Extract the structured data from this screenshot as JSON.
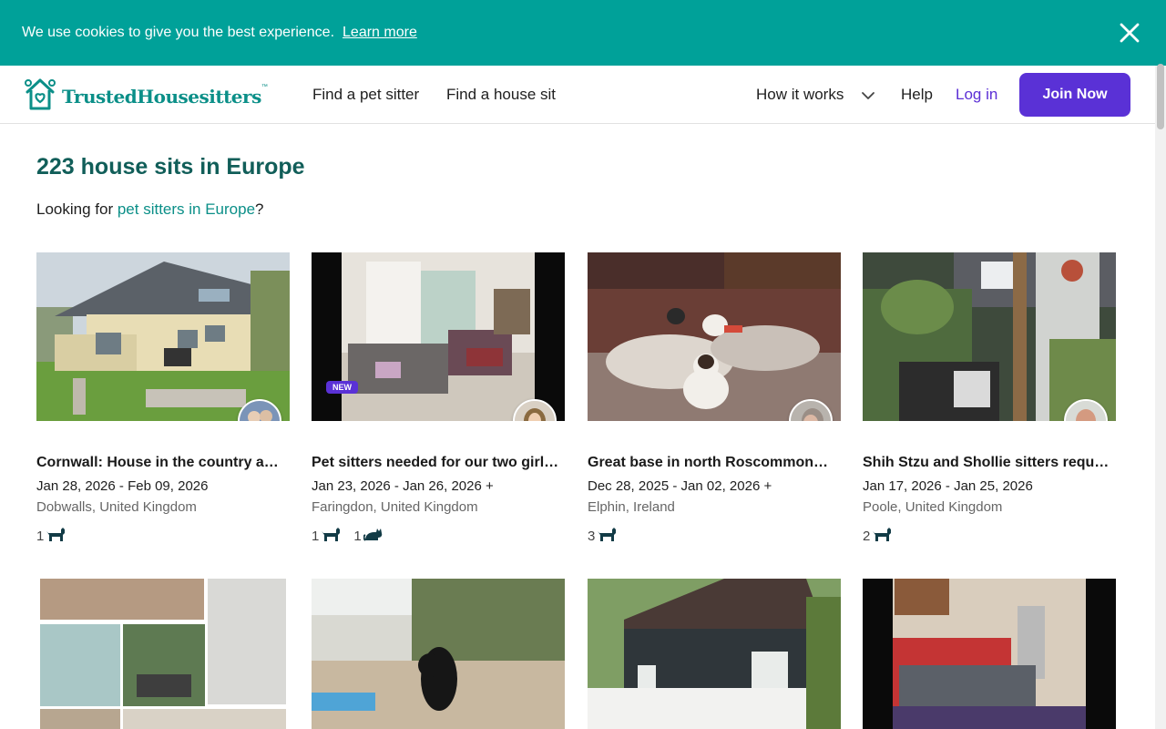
{
  "cookie": {
    "text": "We use cookies to give you the best experience.",
    "link": "Learn more"
  },
  "header": {
    "logo_text": "TrustedHousesitters",
    "logo_tm": "™",
    "nav": {
      "find_pet_sitter": "Find a pet sitter",
      "find_house_sit": "Find a house sit",
      "how_it_works": "How it works",
      "help": "Help",
      "login": "Log in",
      "join": "Join Now"
    }
  },
  "main": {
    "title": "223 house sits in Europe",
    "looking_prefix": "Looking for ",
    "looking_link": "pet sitters in Europe",
    "looking_suffix": "?"
  },
  "colors": {
    "brand_teal": "#00A199",
    "brand_dark_teal": "#115E59",
    "accent_purple": "#5A31D6"
  },
  "listings": [
    {
      "title": "Cornwall: House in the country a…",
      "dates": "Jan 28, 2026 - Feb 09, 2026",
      "location": "Dobwalls, United Kingdom",
      "badge": "",
      "pets": [
        {
          "count": "1",
          "icon": "dog-icon"
        }
      ]
    },
    {
      "title": "Pet sitters needed for our two girl…",
      "dates": "Jan 23, 2026 - Jan 26, 2026 +",
      "location": "Faringdon, United Kingdom",
      "badge": "NEW",
      "pets": [
        {
          "count": "1",
          "icon": "dog-icon"
        },
        {
          "count": "1",
          "icon": "cat-icon"
        }
      ]
    },
    {
      "title": "Great base in north Roscommon…",
      "dates": "Dec 28, 2025 - Jan 02, 2026 +",
      "location": "Elphin, Ireland",
      "badge": "",
      "pets": [
        {
          "count": "3",
          "icon": "dog-icon"
        }
      ]
    },
    {
      "title": "Shih Stzu and Shollie sitters requ…",
      "dates": "Jan 17, 2026 - Jan 25, 2026",
      "location": "Poole, United Kingdom",
      "badge": "",
      "pets": [
        {
          "count": "2",
          "icon": "dog-icon"
        }
      ]
    }
  ]
}
